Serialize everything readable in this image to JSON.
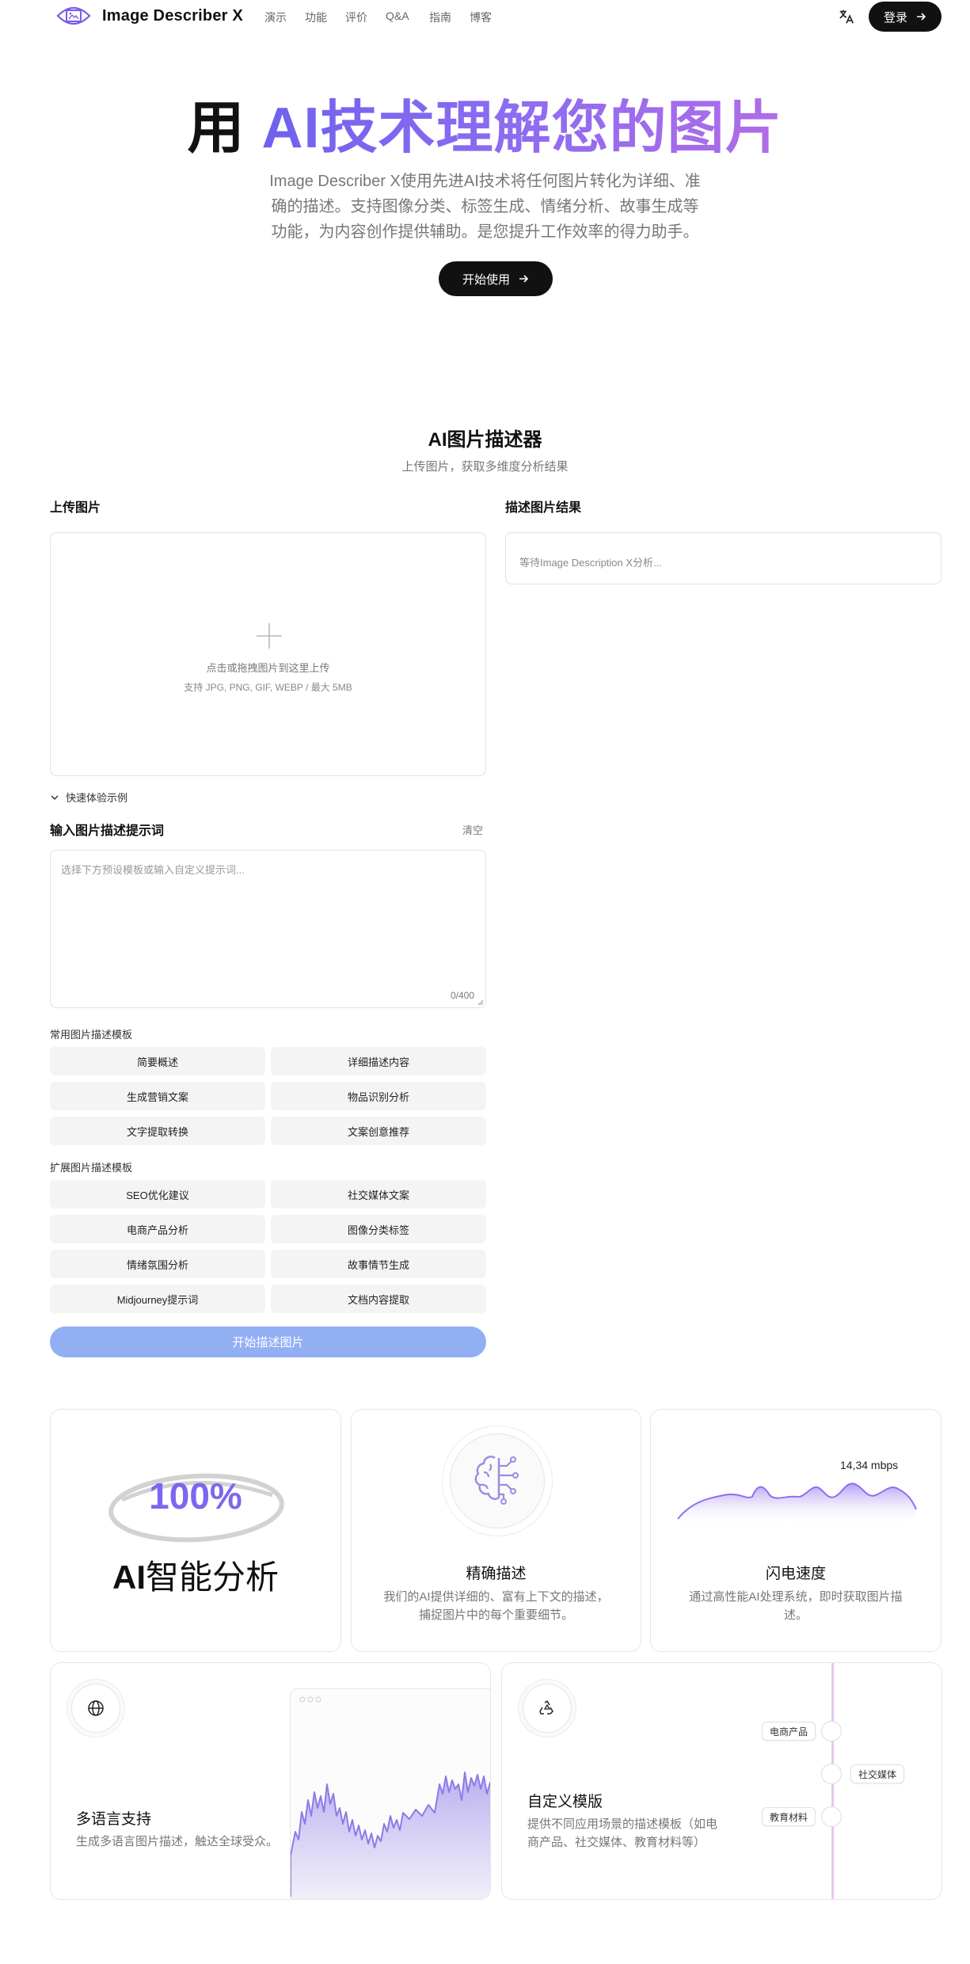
{
  "nav": {
    "brand": "Image Describer X",
    "links": [
      "演示",
      "功能",
      "评价",
      "Q&A",
      "指南",
      "博客"
    ],
    "login_label": "登录"
  },
  "hero": {
    "title_prefix": "用 ",
    "title_highlight": "AI技术理解您的图片",
    "description": "Image Describer X使用先进AI技术将任何图片转化为详细、准确的描述。支持图像分类、标签生成、情绪分析、故事生成等功能，为内容创作提供辅助。是您提升工作效率的得力助手。",
    "cta_label": "开始使用"
  },
  "tool": {
    "title": "AI图片描述器",
    "subtitle": "上传图片，获取多维度分析结果",
    "upload_label": "上传图片",
    "upload_hint": "点击或拖拽图片到这里上传",
    "upload_formats": "支持 JPG, PNG, GIF, WEBP / 最大 5MB",
    "result_label": "描述图片结果",
    "result_placeholder": "等待Image Description X分析...",
    "examples_toggle": "快速体验示例",
    "prompt_label": "输入图片描述提示词",
    "clear_label": "清空",
    "prompt_placeholder": "选择下方预设模板或输入自定义提示词...",
    "char_count": "0/400",
    "common_label": "常用图片描述模板",
    "common_templates": [
      "简要概述",
      "详细描述内容",
      "生成营销文案",
      "物品识别分析",
      "文字提取转换",
      "文案创意推荐"
    ],
    "extended_label": "扩展图片描述模板",
    "extended_templates": [
      "SEO优化建议",
      "社交媒体文案",
      "电商产品分析",
      "图像分类标签",
      "情绪氛围分析",
      "故事情节生成",
      "Midjourney提示词",
      "文档内容提取"
    ],
    "submit_label": "开始描述图片"
  },
  "features": {
    "ai": {
      "stat": "100%",
      "title_bold": "AI",
      "title_rest": "智能分析"
    },
    "precise": {
      "title": "精确描述",
      "desc": "我们的AI提供详细的、富有上下文的描述，捕捉图片中的每个重要细节。"
    },
    "speed": {
      "speed_value": "14,34 mbps",
      "title": "闪电速度",
      "desc": "通过高性能AI处理系统，即时获取图片描述。"
    },
    "multilang": {
      "title": "多语言支持",
      "desc": "生成多语言图片描述，触达全球受众。"
    },
    "custom": {
      "title": "自定义模版",
      "desc": "提供不同应用场景的描述模板（如电商产品、社交媒体、教育材料等）",
      "tags": [
        "电商产品",
        "社交媒体",
        "教育材料"
      ]
    }
  },
  "colors": {
    "accent_purple": "#7b68ee",
    "gradient_end": "#b06ce8",
    "submit_blue": "#92aff4",
    "dark": "#111111"
  },
  "icons": [
    "logo-icon",
    "translate-icon",
    "arrow-right-icon",
    "plus-icon",
    "chevron-down-icon",
    "brain-circuit-icon",
    "globe-icon",
    "recycle-icon"
  ]
}
